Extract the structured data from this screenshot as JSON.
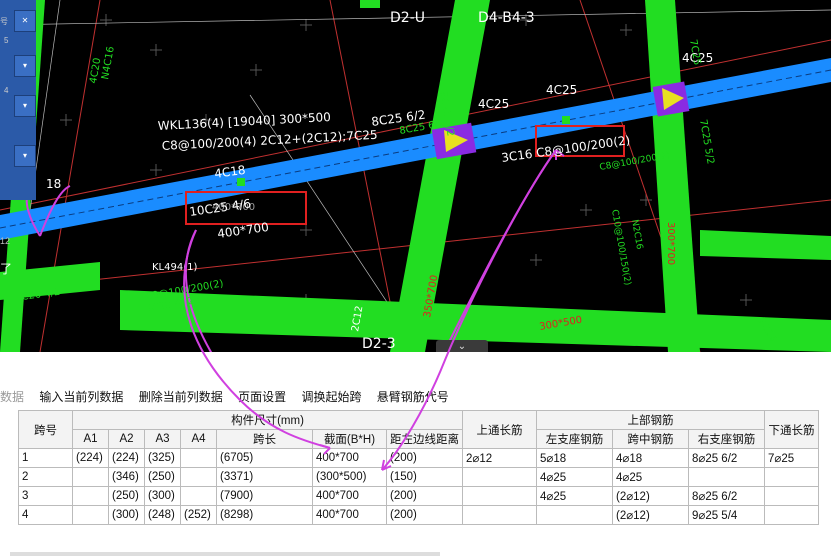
{
  "cad": {
    "grid_labels": [
      "D2-U",
      "D4-B4-3",
      "D2-3"
    ],
    "beam_annotation": [
      "WKL136(4) [19040] 300*500",
      "C8@100/200(4) 2C12+(2C12);7C25"
    ],
    "rebar_labels": [
      "4C25",
      "4C25",
      "4C25",
      "4C18",
      "8C25 6/2",
      "3C16 C8@100/200(2)",
      "10C25 4/6",
      "400*700",
      "KL494(1)",
      "C8@100/200(2)",
      "2C20;4C22",
      "C20 4/2",
      "2C14",
      "400*700",
      "300*700",
      "300*500",
      "350*700",
      "2C12",
      "4C20",
      "N4C16",
      "18"
    ],
    "highlight_labels": [
      "400*700",
      "300*500"
    ],
    "left_panel": [
      "号",
      "5",
      "4",
      "12",
      "了"
    ]
  },
  "collapse_tab": "⌄",
  "toolbar": {
    "items": [
      "数据",
      "输入当前列数据",
      "删除当前列数据",
      "页面设置",
      "调换起始跨",
      "悬臂钢筋代号"
    ]
  },
  "table": {
    "headers_top": {
      "span_no": "跨号",
      "member_size": "构件尺寸(mm)",
      "top_through": "上通长筋",
      "top_rebar": "上部钢筋"
    },
    "headers_sub": [
      "A1",
      "A2",
      "A3",
      "A4",
      "跨长",
      "截面(B*H)",
      "距左边线距离",
      "左支座钢筋",
      "跨中钢筋",
      "右支座钢筋",
      "下通长筋"
    ],
    "rows": [
      [
        "1",
        "(224)",
        "(224)",
        "(325)",
        "",
        "(6705)",
        "400*700",
        "(200)",
        "2⌀12",
        "5⌀18",
        "4⌀18",
        "8⌀25 6/2",
        "7⌀25"
      ],
      [
        "2",
        "",
        "(346)",
        "(250)",
        "",
        "(3371)",
        "(300*500)",
        "(150)",
        "",
        "4⌀25",
        "4⌀25",
        "",
        ""
      ],
      [
        "3",
        "",
        "(250)",
        "(300)",
        "",
        "(7900)",
        "400*700",
        "(200)",
        "",
        "4⌀25",
        "(2⌀12)",
        "8⌀25 6/2",
        ""
      ],
      [
        "4",
        "",
        "(300)",
        "(248)",
        "(252)",
        "(8298)",
        "400*700",
        "(200)",
        "",
        "",
        "(2⌀12)",
        "9⌀25 5/4",
        ""
      ]
    ]
  },
  "colors": {
    "beam_blue": "#1a8cff",
    "column_green": "#22dd22",
    "highlight_red": "#e02020",
    "arrow_magenta": "#d040e0",
    "column_yellow": "#e8e020",
    "column_purple": "#8a2be2"
  }
}
